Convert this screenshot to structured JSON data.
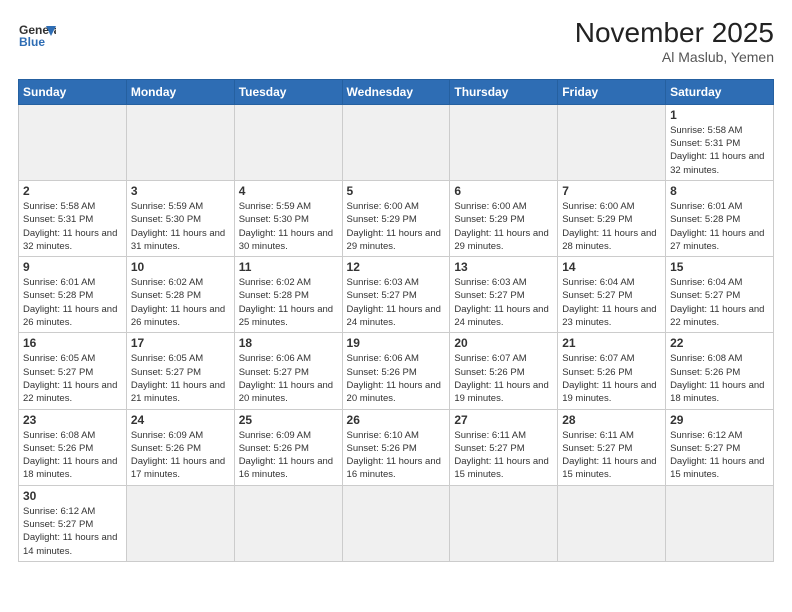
{
  "header": {
    "logo_general": "General",
    "logo_blue": "Blue",
    "title": "November 2025",
    "subtitle": "Al Maslub, Yemen"
  },
  "days_of_week": [
    "Sunday",
    "Monday",
    "Tuesday",
    "Wednesday",
    "Thursday",
    "Friday",
    "Saturday"
  ],
  "weeks": [
    [
      {
        "day": "",
        "empty": true
      },
      {
        "day": "",
        "empty": true
      },
      {
        "day": "",
        "empty": true
      },
      {
        "day": "",
        "empty": true
      },
      {
        "day": "",
        "empty": true
      },
      {
        "day": "",
        "empty": true
      },
      {
        "day": "1",
        "sunrise": "5:58 AM",
        "sunset": "5:31 PM",
        "daylight": "11 hours and 32 minutes."
      }
    ],
    [
      {
        "day": "2",
        "sunrise": "5:58 AM",
        "sunset": "5:31 PM",
        "daylight": "11 hours and 32 minutes."
      },
      {
        "day": "3",
        "sunrise": "5:59 AM",
        "sunset": "5:30 PM",
        "daylight": "11 hours and 31 minutes."
      },
      {
        "day": "4",
        "sunrise": "5:59 AM",
        "sunset": "5:30 PM",
        "daylight": "11 hours and 30 minutes."
      },
      {
        "day": "5",
        "sunrise": "6:00 AM",
        "sunset": "5:29 PM",
        "daylight": "11 hours and 29 minutes."
      },
      {
        "day": "6",
        "sunrise": "6:00 AM",
        "sunset": "5:29 PM",
        "daylight": "11 hours and 29 minutes."
      },
      {
        "day": "7",
        "sunrise": "6:00 AM",
        "sunset": "5:29 PM",
        "daylight": "11 hours and 28 minutes."
      },
      {
        "day": "8",
        "sunrise": "6:01 AM",
        "sunset": "5:28 PM",
        "daylight": "11 hours and 27 minutes."
      }
    ],
    [
      {
        "day": "9",
        "sunrise": "6:01 AM",
        "sunset": "5:28 PM",
        "daylight": "11 hours and 26 minutes."
      },
      {
        "day": "10",
        "sunrise": "6:02 AM",
        "sunset": "5:28 PM",
        "daylight": "11 hours and 26 minutes."
      },
      {
        "day": "11",
        "sunrise": "6:02 AM",
        "sunset": "5:28 PM",
        "daylight": "11 hours and 25 minutes."
      },
      {
        "day": "12",
        "sunrise": "6:03 AM",
        "sunset": "5:27 PM",
        "daylight": "11 hours and 24 minutes."
      },
      {
        "day": "13",
        "sunrise": "6:03 AM",
        "sunset": "5:27 PM",
        "daylight": "11 hours and 24 minutes."
      },
      {
        "day": "14",
        "sunrise": "6:04 AM",
        "sunset": "5:27 PM",
        "daylight": "11 hours and 23 minutes."
      },
      {
        "day": "15",
        "sunrise": "6:04 AM",
        "sunset": "5:27 PM",
        "daylight": "11 hours and 22 minutes."
      }
    ],
    [
      {
        "day": "16",
        "sunrise": "6:05 AM",
        "sunset": "5:27 PM",
        "daylight": "11 hours and 22 minutes."
      },
      {
        "day": "17",
        "sunrise": "6:05 AM",
        "sunset": "5:27 PM",
        "daylight": "11 hours and 21 minutes."
      },
      {
        "day": "18",
        "sunrise": "6:06 AM",
        "sunset": "5:27 PM",
        "daylight": "11 hours and 20 minutes."
      },
      {
        "day": "19",
        "sunrise": "6:06 AM",
        "sunset": "5:26 PM",
        "daylight": "11 hours and 20 minutes."
      },
      {
        "day": "20",
        "sunrise": "6:07 AM",
        "sunset": "5:26 PM",
        "daylight": "11 hours and 19 minutes."
      },
      {
        "day": "21",
        "sunrise": "6:07 AM",
        "sunset": "5:26 PM",
        "daylight": "11 hours and 19 minutes."
      },
      {
        "day": "22",
        "sunrise": "6:08 AM",
        "sunset": "5:26 PM",
        "daylight": "11 hours and 18 minutes."
      }
    ],
    [
      {
        "day": "23",
        "sunrise": "6:08 AM",
        "sunset": "5:26 PM",
        "daylight": "11 hours and 18 minutes."
      },
      {
        "day": "24",
        "sunrise": "6:09 AM",
        "sunset": "5:26 PM",
        "daylight": "11 hours and 17 minutes."
      },
      {
        "day": "25",
        "sunrise": "6:09 AM",
        "sunset": "5:26 PM",
        "daylight": "11 hours and 16 minutes."
      },
      {
        "day": "26",
        "sunrise": "6:10 AM",
        "sunset": "5:26 PM",
        "daylight": "11 hours and 16 minutes."
      },
      {
        "day": "27",
        "sunrise": "6:11 AM",
        "sunset": "5:27 PM",
        "daylight": "11 hours and 15 minutes."
      },
      {
        "day": "28",
        "sunrise": "6:11 AM",
        "sunset": "5:27 PM",
        "daylight": "11 hours and 15 minutes."
      },
      {
        "day": "29",
        "sunrise": "6:12 AM",
        "sunset": "5:27 PM",
        "daylight": "11 hours and 15 minutes."
      }
    ],
    [
      {
        "day": "30",
        "sunrise": "6:12 AM",
        "sunset": "5:27 PM",
        "daylight": "11 hours and 14 minutes."
      },
      {
        "day": "",
        "empty": true
      },
      {
        "day": "",
        "empty": true
      },
      {
        "day": "",
        "empty": true
      },
      {
        "day": "",
        "empty": true
      },
      {
        "day": "",
        "empty": true
      },
      {
        "day": "",
        "empty": true
      }
    ]
  ]
}
